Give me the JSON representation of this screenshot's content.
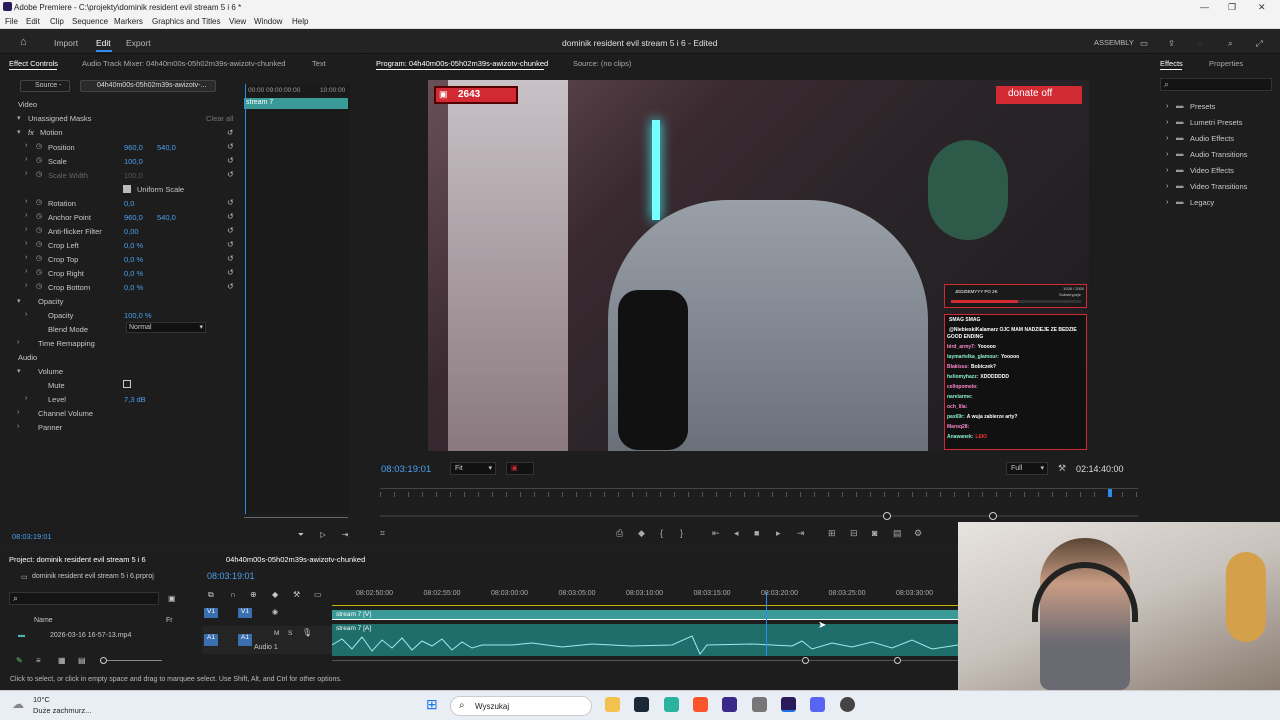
{
  "window": {
    "title": "Adobe Premiere - C:\\projekty\\dominik resident evil stream 5 i 6 *"
  },
  "menu": [
    "File",
    "Edit",
    "Clip",
    "Sequence",
    "Markers",
    "Graphics and Titles",
    "View",
    "Window",
    "Help"
  ],
  "workspace": {
    "tabs": [
      "Import",
      "Edit",
      "Export"
    ],
    "active": "Edit",
    "project_title": "dominik resident evil stream 5 i 6 - Edited",
    "layout_label": "ASSEMBLY"
  },
  "effect_controls": {
    "tabs": [
      "Effect Controls",
      "Audio Track Mixer: 04h40m00s-05h02m39s-awizotv-chunked",
      "Text"
    ],
    "source_label": "Source -",
    "clip_label": "04h40m00s-05h02m39s-awizotv-...",
    "mini_timecodes": [
      "00:00",
      "09:00:00:00",
      "10:00:00"
    ],
    "mini_clip": "stream 7",
    "video_label": "Video",
    "unassigned_masks": "Unassigned Masks",
    "clear_all": "Clear all",
    "motion": "Motion",
    "props": [
      {
        "name": "Position",
        "v1": "960,0",
        "v2": "540,0"
      },
      {
        "name": "Scale",
        "v1": "100,0",
        "v2": ""
      },
      {
        "name": "Scale Width",
        "v1": "100,0",
        "v2": ""
      },
      {
        "name": "Uniform Scale",
        "v1": "",
        "v2": ""
      },
      {
        "name": "Rotation",
        "v1": "0,0",
        "v2": ""
      },
      {
        "name": "Anchor Point",
        "v1": "960,0",
        "v2": "540,0"
      },
      {
        "name": "Anti-flicker Filter",
        "v1": "0,00",
        "v2": ""
      },
      {
        "name": "Crop Left",
        "v1": "0,0 %",
        "v2": ""
      },
      {
        "name": "Crop Top",
        "v1": "0,0 %",
        "v2": ""
      },
      {
        "name": "Crop Right",
        "v1": "0,0 %",
        "v2": ""
      },
      {
        "name": "Crop Bottom",
        "v1": "0,0 %",
        "v2": ""
      }
    ],
    "opacity": "Opacity",
    "opacity_value": "100,0 %",
    "blend_mode_label": "Blend Mode",
    "blend_mode": "Normal",
    "time_remapping": "Time Remapping",
    "audio_label": "Audio",
    "volume": "Volume",
    "mute": "Mute",
    "level": "Level",
    "level_value": "7,3 dB",
    "channel_volume": "Channel Volume",
    "panner": "Panner",
    "timecode": "08:03:19:01"
  },
  "program": {
    "tabs": [
      "Program: 04h40m00s-05h02m39s-awizotv-chunked",
      "Source: (no clips)"
    ],
    "timecode": "08:03:19:01",
    "fit": "Fit",
    "quality": "Full",
    "duration": "02:14:40:00",
    "overlay": {
      "viewer_count": "2643",
      "donate": "donate off",
      "goal_text": "JEDZIEMYYY PO 2K",
      "goal_count": "1028 / 2000",
      "goal_label": "Subskrypcje",
      "chat": [
        {
          "user": "",
          "msg": "SMAG SMAG"
        },
        {
          "user": "",
          "msg": "@NiebieskiKalamarz OJC MAM NADZIEJE ZE BEDZIE GOOD ENDING"
        },
        {
          "user": "bird_army7:",
          "msg": "Yooooo"
        },
        {
          "user": "taymartelka_glamour:",
          "msg": "Yooooo"
        },
        {
          "user": "Blakisss:",
          "msg": "Bobiczek?"
        },
        {
          "user": "heliomyhazz:",
          "msg": "XDDDDDDD"
        },
        {
          "user": "cellopomelo:",
          "msg": ""
        },
        {
          "user": "narelarme:",
          "msg": ""
        },
        {
          "user": "och_lila:",
          "msg": ""
        },
        {
          "user": "pax69r:",
          "msg": "A wuja zabierze arty?"
        },
        {
          "user": "Maroq28:",
          "msg": ""
        },
        {
          "user": "Anawanek:",
          "msg": "LEKI"
        }
      ]
    }
  },
  "effects": {
    "tabs": [
      "Effects",
      "Properties"
    ],
    "items": [
      "Presets",
      "Lumetri Presets",
      "Audio Effects",
      "Audio Transitions",
      "Video Effects",
      "Video Transitions",
      "Legacy"
    ]
  },
  "project": {
    "tab": "Project: dominik resident evil stream 5 i 6",
    "file": "dominik resident evil stream 5 i 6.prproj",
    "col_name": "Name",
    "col_fr": "Fr",
    "item": "2026-03-16 16-57-13.mp4"
  },
  "timeline": {
    "tab": "04h40m00s-05h02m39s-awizotv-chunked",
    "timecode": "08:03:19:01",
    "ruler": [
      "08:02:50:00",
      "08:02:55:00",
      "08:03:00:00",
      "08:03:05:00",
      "08:03:10:00",
      "08:03:15:00",
      "08:03:20:00",
      "08:03:25:00",
      "08:03:30:00"
    ],
    "v1": "V1",
    "a1": "A1",
    "audio_track": "Audio 1",
    "video_clip": "stream 7 [V]",
    "audio_clip": "stream 7 [A]"
  },
  "status": "Click to select, or click in empty space and drag to marquee select. Use Shift, Alt, and Ctrl for other options.",
  "taskbar": {
    "temp": "10°C",
    "weather": "Duże zachmurz...",
    "search": "Wyszukaj"
  },
  "colors": {
    "accent": "#2d8ceb",
    "clip": "#4fb5b2",
    "twitch": "#d12a33"
  }
}
